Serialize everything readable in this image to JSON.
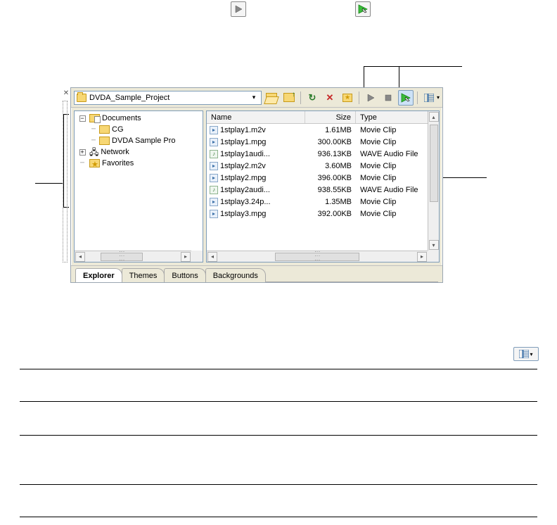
{
  "icons_top": {
    "play": "play-icon",
    "auto": "auto-preview-icon"
  },
  "toolbar": {
    "path_label": "DVDA_Sample_Project",
    "btn_open": "Open",
    "btn_up": "Up one level",
    "btn_refresh": "Refresh",
    "btn_delete": "Delete",
    "btn_fav": "Add to Favorites",
    "btn_play": "Start Preview",
    "btn_stop": "Stop Preview",
    "btn_auto": "Auto Preview",
    "btn_views": "Views"
  },
  "tree": {
    "items": [
      {
        "expander": "-",
        "indent": 0,
        "icon": "folder-docs",
        "label": "Documents"
      },
      {
        "expander": "",
        "indent": 1,
        "icon": "folder",
        "label": "CG"
      },
      {
        "expander": "",
        "indent": 1,
        "icon": "folder",
        "label": "DVDA Sample Pro"
      },
      {
        "expander": "+",
        "indent": 0,
        "icon": "network",
        "label": "Network"
      },
      {
        "expander": "",
        "indent": 0,
        "icon": "favorites",
        "label": "Favorites"
      }
    ]
  },
  "list": {
    "columns": {
      "name": "Name",
      "size": "Size",
      "type": "Type"
    },
    "rows": [
      {
        "icon": "video",
        "name": "1stplay1.m2v",
        "size": "1.61MB",
        "type": "Movie Clip"
      },
      {
        "icon": "video",
        "name": "1stplay1.mpg",
        "size": "300.00KB",
        "type": "Movie Clip"
      },
      {
        "icon": "audio",
        "name": "1stplay1audi...",
        "size": "936.13KB",
        "type": "WAVE Audio File"
      },
      {
        "icon": "video",
        "name": "1stplay2.m2v",
        "size": "3.60MB",
        "type": "Movie Clip"
      },
      {
        "icon": "video",
        "name": "1stplay2.mpg",
        "size": "396.00KB",
        "type": "Movie Clip"
      },
      {
        "icon": "audio",
        "name": "1stplay2audi...",
        "size": "938.55KB",
        "type": "WAVE Audio File"
      },
      {
        "icon": "video",
        "name": "1stplay3.24p...",
        "size": "1.35MB",
        "type": "Movie Clip"
      },
      {
        "icon": "video",
        "name": "1stplay3.mpg",
        "size": "392.00KB",
        "type": "Movie Clip"
      }
    ]
  },
  "tabs": {
    "items": [
      {
        "label": "Explorer",
        "active": true
      },
      {
        "label": "Themes",
        "active": false
      },
      {
        "label": "Buttons",
        "active": false
      },
      {
        "label": "Backgrounds",
        "active": false
      }
    ]
  },
  "standalone_views_title": "Views"
}
